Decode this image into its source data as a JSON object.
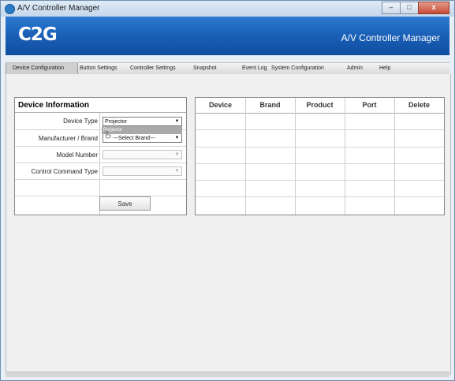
{
  "window": {
    "title": "A/V Controller Manager",
    "controls": {
      "minimize": "–",
      "maximize": "□",
      "close": "x"
    }
  },
  "banner": {
    "logo": "C2G",
    "title": "A/V Controller Manager"
  },
  "nav": {
    "items": [
      {
        "label": "Device Configuration",
        "active": true
      },
      {
        "label": "Button Settings"
      },
      {
        "label": "Controller Settings"
      },
      {
        "label": "Snapshot"
      },
      {
        "label": "Event Log"
      },
      {
        "label": "System Configuration"
      },
      {
        "label": "Admin"
      },
      {
        "label": "Help"
      }
    ]
  },
  "device_info": {
    "heading": "Device Information",
    "device_type": {
      "label": "Device Type",
      "value": "Projector"
    },
    "brand": {
      "label": "Manufacturer / Brand",
      "value": "---Select Brand---"
    },
    "model": {
      "label": "Model Number",
      "value": ""
    },
    "command_type": {
      "label": "Control Command Type",
      "value": ""
    },
    "dropdown_option": "Projector",
    "save_label": "Save"
  },
  "device_table": {
    "columns": [
      "Device",
      "Brand",
      "Product",
      "Port",
      "Delete"
    ],
    "rows": []
  }
}
